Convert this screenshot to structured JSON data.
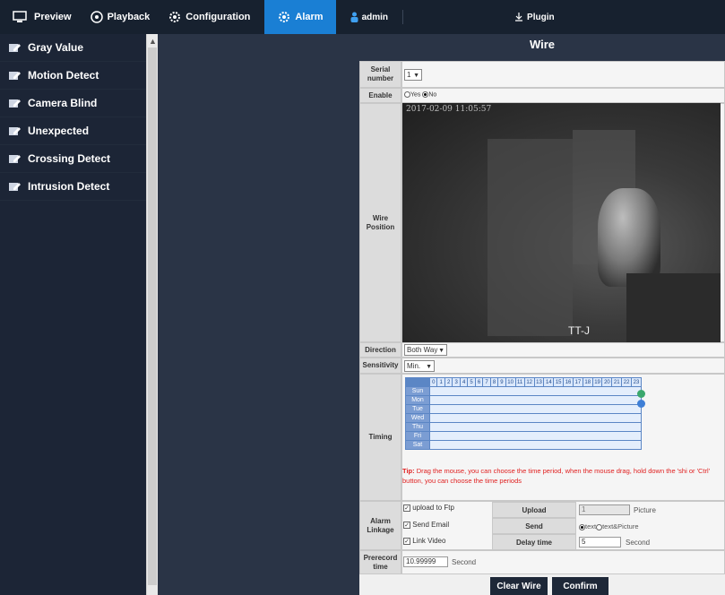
{
  "topbar": {
    "preview": "Preview",
    "playback": "Playback",
    "configuration": "Configuration",
    "alarm": "Alarm",
    "user": "admin",
    "plugin": "Plugin"
  },
  "sidebar": {
    "items": [
      {
        "label": "Gray Value"
      },
      {
        "label": "Motion Detect"
      },
      {
        "label": "Camera Blind"
      },
      {
        "label": "Unexpected"
      },
      {
        "label": "Crossing Detect"
      },
      {
        "label": "Intrusion Detect"
      }
    ]
  },
  "page": {
    "title": "Wire"
  },
  "form": {
    "serial_label": "Serial number",
    "serial_value": "1",
    "enable_label": "Enable",
    "enable_yes": "Yes",
    "enable_no": "No",
    "enable_selected": "No",
    "wire_position_label": "Wire Position",
    "video_timestamp": "2017-02-09 11:05:57",
    "video_camera_name": "TT-J",
    "direction_label": "Direction",
    "direction_value": "Both Way",
    "sensitivity_label": "Sensitivity",
    "sensitivity_value": "Min.",
    "timing_label": "Timing",
    "timing_hours": [
      "0",
      "1",
      "2",
      "3",
      "4",
      "5",
      "6",
      "7",
      "8",
      "9",
      "10",
      "11",
      "12",
      "13",
      "14",
      "15",
      "16",
      "17",
      "18",
      "19",
      "20",
      "21",
      "22",
      "23"
    ],
    "timing_days": [
      "Sun",
      "Mon",
      "Tue",
      "Wed",
      "Thu",
      "Fri",
      "Sat"
    ],
    "tip_prefix": "Tip:",
    "tip_text": "Drag the mouse, you can choose the time period, when the mouse drag, hold down the 'shi or 'Ctrl' button, you can choose the time periods",
    "alarm_linkage_label": "Alarm Linkage",
    "upload_ftp": "upload to Ftp",
    "send_email": "Send Email",
    "link_video": "Link Video",
    "upload_label": "Upload",
    "upload_value": "1",
    "upload_unit": "Picture",
    "send_label": "Send",
    "send_opt1": "text",
    "send_opt2": "text&Picture",
    "delay_label": "Delay time",
    "delay_value": "5",
    "delay_unit": "Second",
    "prerecord_label": "Prerecord time",
    "prerecord_value": "10.99999",
    "prerecord_unit": "Second",
    "clear_wire": "Clear Wire",
    "confirm": "Confirm"
  },
  "colors": {
    "topbar_bg": "#17212f",
    "active_tab": "#1a7fd4",
    "sidebar_bg": "#1c2536",
    "main_bg": "#2a3446",
    "tip_red": "#e02020",
    "grid_blue": "#5b86c5"
  }
}
